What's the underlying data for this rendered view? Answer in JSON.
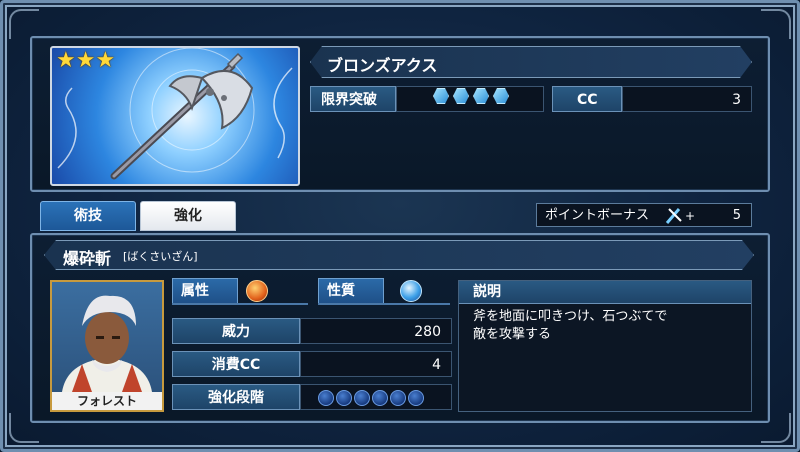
{
  "weapon": {
    "name": "ブロンズアクス",
    "rarity_stars": 3,
    "limit_break_label": "限界突破",
    "limit_break_count": 4,
    "cc_label": "CC",
    "cc_value": "3"
  },
  "tabs": [
    {
      "label": "術技",
      "active": true
    },
    {
      "label": "強化",
      "active": false
    }
  ],
  "point_bonus": {
    "label": "ポイントボーナス",
    "plus": "+",
    "value": "5"
  },
  "skill": {
    "name": "爆砕斬",
    "reading": "[ばくさいざん]",
    "attribute_label": "属性",
    "nature_label": "性質",
    "power_label": "威力",
    "power_value": "280",
    "cost_label": "消費CC",
    "cost_value": "4",
    "enhance_label": "強化段階",
    "enhance_levels": 6,
    "description_label": "説明",
    "description": "斧を地面に叩きつけ、石つぶてで\n敵を攻撃する"
  },
  "character": {
    "name": "フォレスト"
  },
  "colors": {
    "frame": "#6f8fb0",
    "accent_blue": "#2b72b8",
    "star_gold": "#ffd83a",
    "portrait_border": "#c79a3e"
  }
}
